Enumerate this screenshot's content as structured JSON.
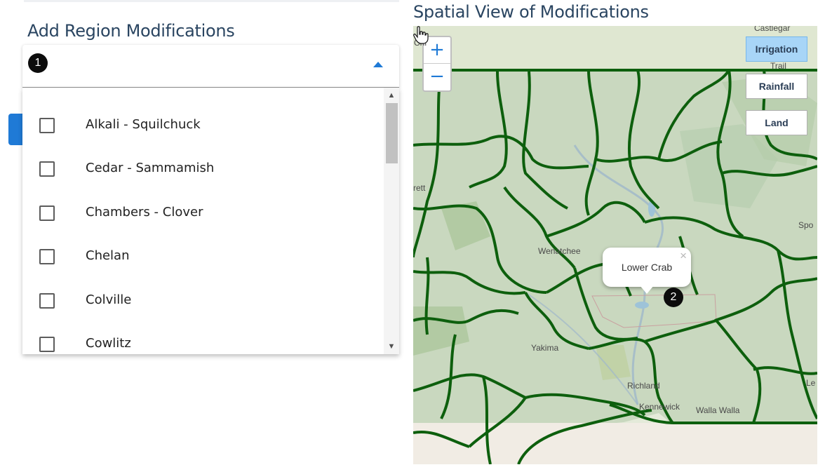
{
  "left_panel": {
    "title": "Add Region Modifications",
    "step_badge": "1",
    "options": [
      {
        "label": "Alkali - Squilchuck",
        "checked": false
      },
      {
        "label": "Cedar - Sammamish",
        "checked": false
      },
      {
        "label": "Chambers - Clover",
        "checked": false
      },
      {
        "label": "Chelan",
        "checked": false
      },
      {
        "label": "Colville",
        "checked": false
      },
      {
        "label": "Cowlitz",
        "checked": false
      }
    ]
  },
  "map_panel": {
    "title": "Spatial View of Modifications",
    "zoom_in": "+",
    "zoom_out": "−",
    "layer_buttons": [
      "Irrigation",
      "Rainfall",
      "Land"
    ],
    "active_layer": "Irrigation",
    "place_labels": [
      "Wenatchee",
      "Yakima",
      "Richland",
      "Kennewick",
      "Walla Walla",
      "Spo",
      "Trail",
      "Castlegar",
      "Le",
      "Chi",
      "rett"
    ],
    "popup": {
      "title": "Lower Crab",
      "close": "×"
    },
    "step_badge": "2"
  },
  "colors": {
    "accent": "#1f7ad6",
    "heading": "#2a4561",
    "region_border": "#0d5f0d",
    "active_layer_bg": "#a8d5f7"
  },
  "icons": {
    "dropdown_caret": "caret-up-icon",
    "cursor": "hand-pointer-icon",
    "popup_close": "close-icon"
  }
}
